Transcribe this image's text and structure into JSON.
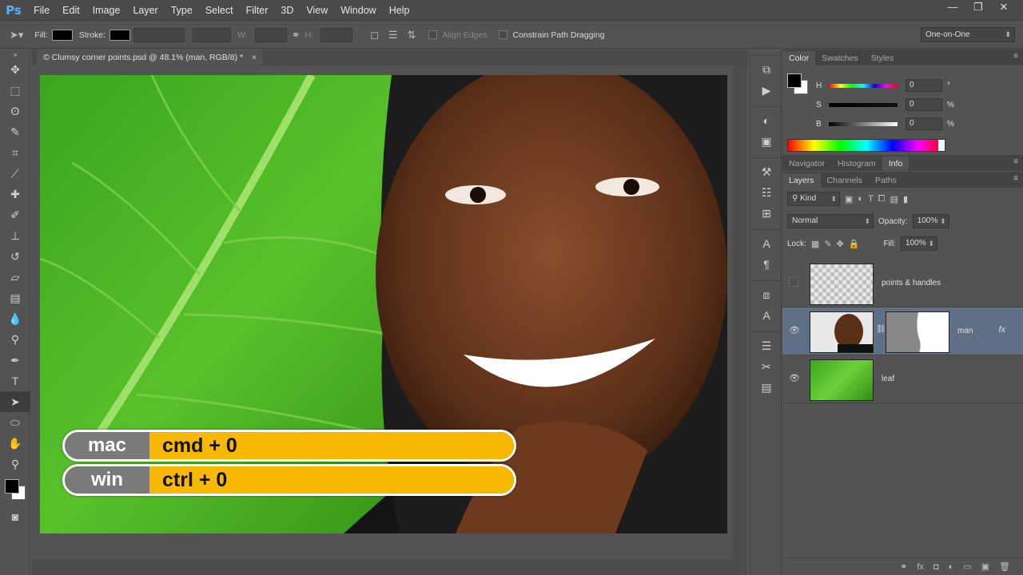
{
  "app": {
    "logo": "Ps"
  },
  "menu": [
    "File",
    "Edit",
    "Image",
    "Layer",
    "Type",
    "Select",
    "Filter",
    "3D",
    "View",
    "Window",
    "Help"
  ],
  "window_controls": [
    "—",
    "❐",
    "✕"
  ],
  "options": {
    "fill_label": "Fill:",
    "stroke_label": "Stroke:",
    "w_label": "W:",
    "h_label": "H:",
    "align_edges": "Align Edges",
    "constrain_path": "Constrain Path Dragging",
    "workspace": "One-on-One"
  },
  "document": {
    "tab_title": "© Clumsy corner points.psd @ 48.1% (man, RGB/8) *",
    "close": "×"
  },
  "shortcuts": [
    {
      "os": "mac",
      "keys": "cmd + 0"
    },
    {
      "os": "win",
      "keys": "ctrl + 0"
    }
  ],
  "color_panel": {
    "tabs": [
      "Color",
      "Swatches",
      "Styles"
    ],
    "sliders": [
      {
        "label": "H",
        "value": "0",
        "unit": "°"
      },
      {
        "label": "S",
        "value": "0",
        "unit": "%"
      },
      {
        "label": "B",
        "value": "0",
        "unit": "%"
      }
    ]
  },
  "info_panel": {
    "tabs": [
      "Navigator",
      "Histogram",
      "Info"
    ]
  },
  "layers_panel": {
    "tabs": [
      "Layers",
      "Channels",
      "Paths"
    ],
    "kind": "Kind",
    "blend_mode": "Normal",
    "opacity_label": "Opacity:",
    "opacity_value": "100%",
    "lock_label": "Lock:",
    "fill_label": "Fill:",
    "fill_value": "100%",
    "layers": [
      {
        "name": "points & handles",
        "visible": false,
        "selected": false
      },
      {
        "name": "man",
        "visible": true,
        "selected": true,
        "fx": "fx"
      },
      {
        "name": "leaf",
        "visible": true,
        "selected": false
      }
    ]
  },
  "colors": {
    "accent": "#f9b800",
    "selection": "#5f6f85",
    "ui_dark": "#535353"
  }
}
